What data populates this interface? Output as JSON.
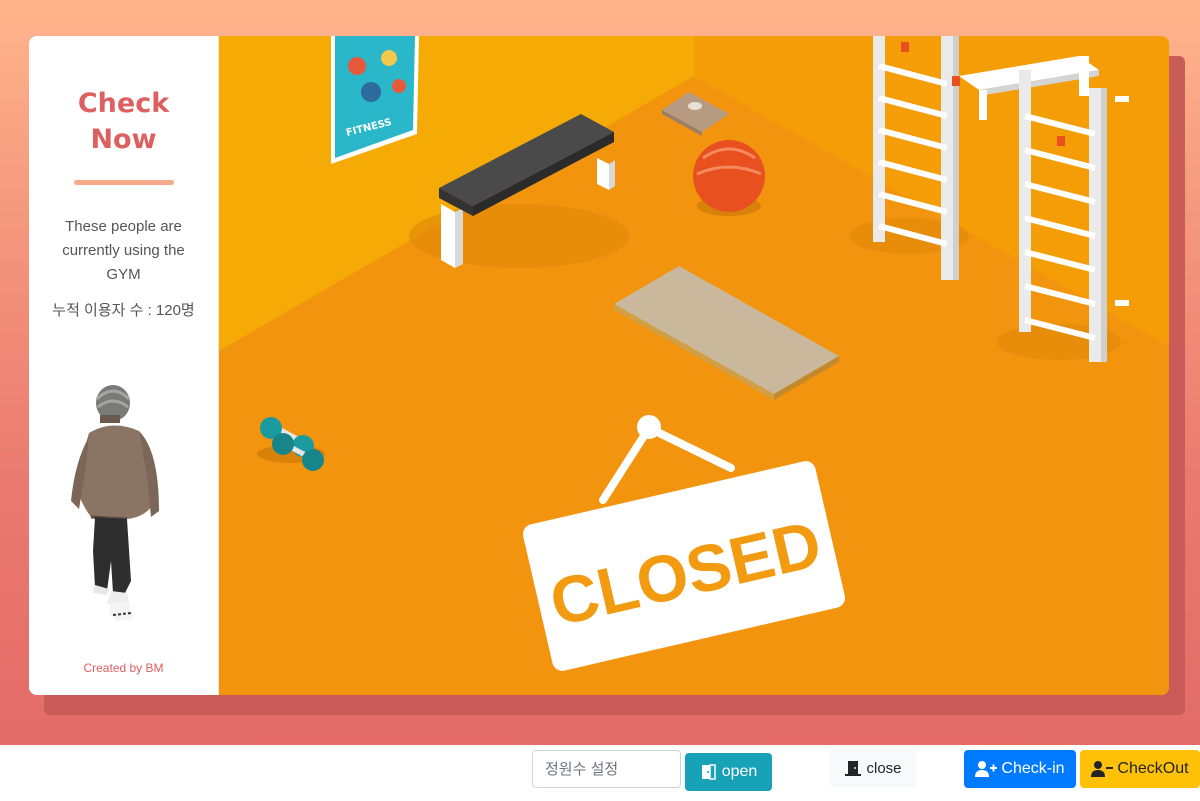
{
  "sidebar": {
    "brand_line1": "Check",
    "brand_line2": "Now",
    "description": "These people are currently using the GYM",
    "cumulative_users": "누적 이용자 수 : 120명",
    "credit": "Created by BM"
  },
  "scene": {
    "sign_text": "CLOSED",
    "poster_text": "FITNESS"
  },
  "toolbar": {
    "capacity_placeholder": "정원수 설정",
    "open_label": "open",
    "close_label": "close",
    "checkin_label": "Check-in",
    "checkout_label": "CheckOut"
  },
  "colors": {
    "brand": "#dd5f5f",
    "open": "#17a2b8",
    "checkin": "#007bff",
    "checkout": "#ffc107",
    "gym_floor": "#f29a10"
  }
}
